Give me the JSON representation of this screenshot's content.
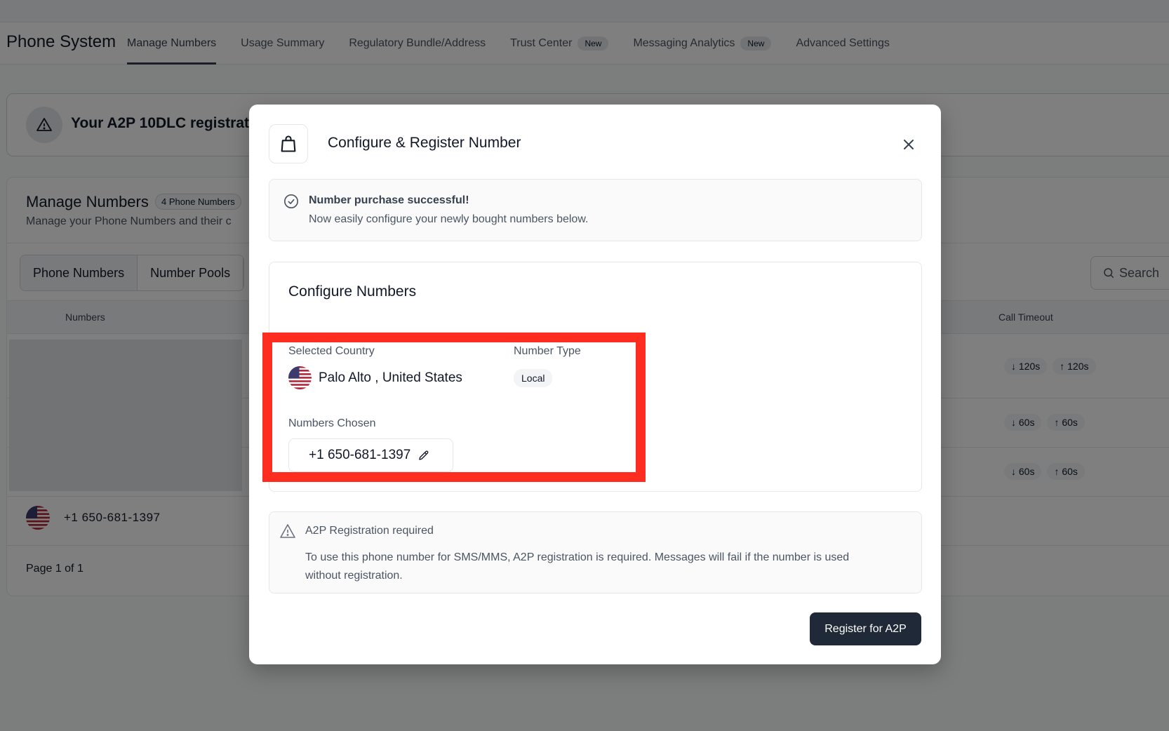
{
  "app": {
    "title": "Phone System",
    "tabs": [
      {
        "label": "Manage Numbers",
        "active": true
      },
      {
        "label": "Usage Summary"
      },
      {
        "label": "Regulatory Bundle/Address"
      },
      {
        "label": "Trust Center",
        "badge": "New"
      },
      {
        "label": "Messaging Analytics",
        "badge": "New"
      },
      {
        "label": "Advanced Settings"
      }
    ]
  },
  "banner": {
    "text": "Your A2P 10DLC registrati",
    "icon": "warning-icon"
  },
  "manage": {
    "title": "Manage Numbers",
    "count_badge": "4 Phone Numbers",
    "subtitle": "Manage your Phone Numbers and their c",
    "segments": [
      "Phone Numbers",
      "Number Pools"
    ],
    "search_label": "Search",
    "columns": {
      "numbers": "Numbers",
      "call_timeout": "Call Timeout"
    },
    "timeouts": [
      {
        "in": "120s",
        "out": "120s"
      },
      {
        "in": "60s",
        "out": "60s"
      },
      {
        "in": "60s",
        "out": "60s"
      }
    ],
    "visible_number": "+1 650-681-1397",
    "pagination": "Page 1 of 1"
  },
  "modal": {
    "title": "Configure & Register Number",
    "icon": "shopping-bag-icon",
    "success": {
      "title": "Number purchase successful!",
      "description": "Now easily configure your newly bought numbers below."
    },
    "configure": {
      "title": "Configure Numbers",
      "selected_country_label": "Selected Country",
      "selected_country_value": "Palo Alto , United States",
      "number_type_label": "Number Type",
      "number_type_value": "Local",
      "numbers_chosen_label": "Numbers Chosen",
      "numbers_chosen": [
        "+1 650-681-1397"
      ]
    },
    "a2p": {
      "title": "A2P Registration required",
      "description": "To use this phone number for SMS/MMS, A2P registration is required. Messages will fail if the number is used without registration."
    },
    "register_button": "Register for A2P"
  },
  "colors": {
    "highlight": "#ff2d20",
    "primary_button": "#1f2937",
    "overlay": "rgba(0,0,0,0.5)"
  }
}
